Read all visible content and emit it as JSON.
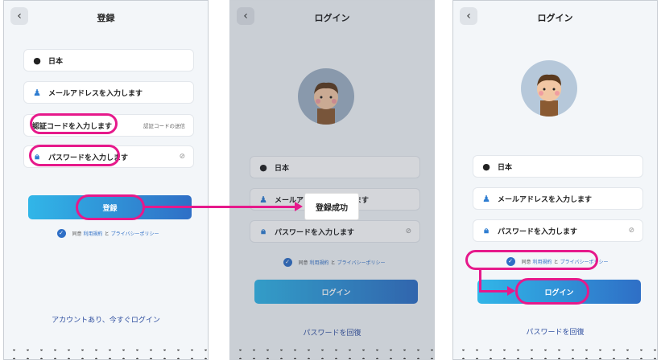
{
  "register": {
    "title": "登録",
    "country": "日本",
    "email_placeholder": "メールアドレスを入力します",
    "code_placeholder": "認証コードを入力します",
    "send_code": "認証コードの送信",
    "password_placeholder": "パスワードを入力します",
    "submit": "登録",
    "agree_prefix": "同意",
    "terms": "利用規約",
    "and": "と",
    "privacy": "プライバシーポリシー",
    "login_link": "アカウントあり、今すぐログイン"
  },
  "login_toast": {
    "title": "ログイン",
    "country": "日本",
    "email_placeholder": "メールアドレスを入力します",
    "password_placeholder": "パスワードを入力します",
    "agree_prefix": "同意",
    "terms": "利用規約",
    "and": "と",
    "privacy": "プライバシーポリシー",
    "submit": "ログイン",
    "recover": "パスワードを回復",
    "toast": "登録成功"
  },
  "login": {
    "title": "ログイン",
    "country": "日本",
    "email_placeholder": "メールアドレスを入力します",
    "password_placeholder": "パスワードを入力します",
    "agree_prefix": "同意",
    "terms": "利用規約",
    "and": "と",
    "privacy": "プライバシーポリシー",
    "submit": "ログイン",
    "recover": "パスワードを回復"
  },
  "icons": {
    "back": "back-chevron-icon",
    "globe": "globe-icon",
    "user": "user-icon",
    "lock": "lock-icon",
    "eye": "eye-hidden-icon",
    "check": "check-circle-icon"
  },
  "colors": {
    "accent_start": "#31b6e8",
    "accent_end": "#2f6fc6",
    "highlight": "#e6198b"
  }
}
